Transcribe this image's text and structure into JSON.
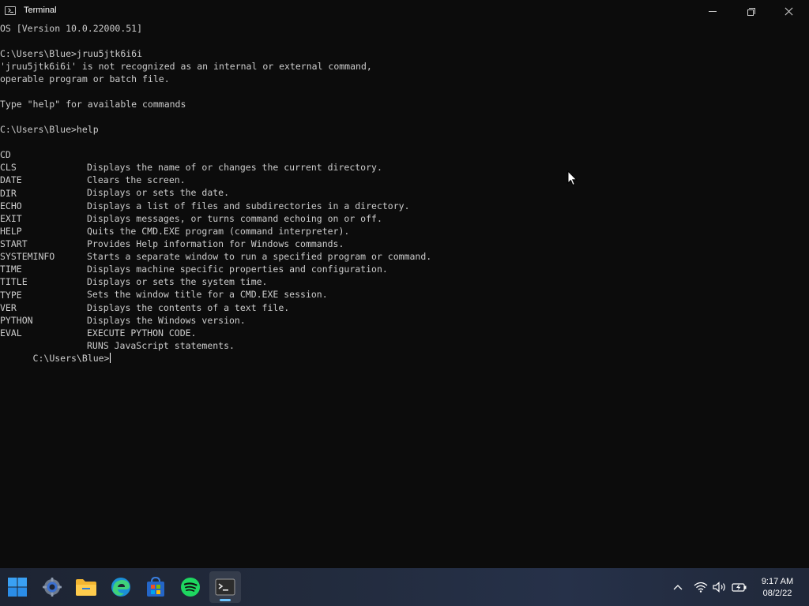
{
  "window": {
    "title": "Terminal",
    "title_icon": "terminal-app-icon",
    "controls": [
      "minimize-icon",
      "maximize-icon",
      "close-icon"
    ]
  },
  "terminal": {
    "lines": [
      "OS [Version 10.0.22000.51]",
      "",
      "C:\\Users\\Blue>jruu5jtk6i6i",
      "'jruu5jtk6i6i' is not recognized as an internal or external command,",
      "operable program or batch file.",
      "",
      "Type \"help\" for available commands",
      "",
      "C:\\Users\\Blue>help"
    ],
    "help_entries": [
      {
        "cmd": "CD",
        "desc": "Displays the name of or changes the current directory."
      },
      {
        "cmd": "CLS",
        "desc": "Clears the screen."
      },
      {
        "cmd": "DATE",
        "desc": "Displays or sets the date."
      },
      {
        "cmd": "DIR",
        "desc": "Displays a list of files and subdirectories in a directory."
      },
      {
        "cmd": "ECHO",
        "desc": "Displays messages, or turns command echoing on or off."
      },
      {
        "cmd": "EXIT",
        "desc": "Quits the CMD.EXE program (command interpreter)."
      },
      {
        "cmd": "HELP",
        "desc": "Provides Help information for Windows commands."
      },
      {
        "cmd": "START",
        "desc": "Starts a separate window to run a specified program or command."
      },
      {
        "cmd": "SYSTEMINFO",
        "desc": "Displays machine specific properties and configuration."
      },
      {
        "cmd": "TIME",
        "desc": "Displays or sets the system time."
      },
      {
        "cmd": "TITLE",
        "desc": "Sets the window title for a CMD.EXE session."
      },
      {
        "cmd": "TYPE",
        "desc": "Displays the contents of a text file."
      },
      {
        "cmd": "VER",
        "desc": "Displays the Windows version."
      },
      {
        "cmd": "PYTHON",
        "desc": "EXECUTE PYTHON CODE."
      },
      {
        "cmd": "EVAL",
        "desc": "RUNS JavaScript statements."
      }
    ],
    "prompt": "C:\\Users\\Blue>"
  },
  "taskbar": {
    "apps": [
      {
        "name": "start-icon",
        "active": false
      },
      {
        "name": "settings-icon",
        "active": false
      },
      {
        "name": "file-explorer-icon",
        "active": false
      },
      {
        "name": "edge-icon",
        "active": false
      },
      {
        "name": "store-icon",
        "active": false
      },
      {
        "name": "spotify-icon",
        "active": false
      },
      {
        "name": "terminal-icon",
        "active": true
      }
    ],
    "tray": [
      "chevron-up-icon",
      "wifi-icon",
      "volume-icon",
      "battery-icon"
    ],
    "clock": {
      "time": "9:17 AM",
      "date": "08/2/22"
    }
  },
  "colors": {
    "terminal_bg": "#0c0c0c",
    "terminal_text": "#cccccc",
    "taskbar_bg": "#222b3d",
    "accent": "#6cc4ff"
  }
}
